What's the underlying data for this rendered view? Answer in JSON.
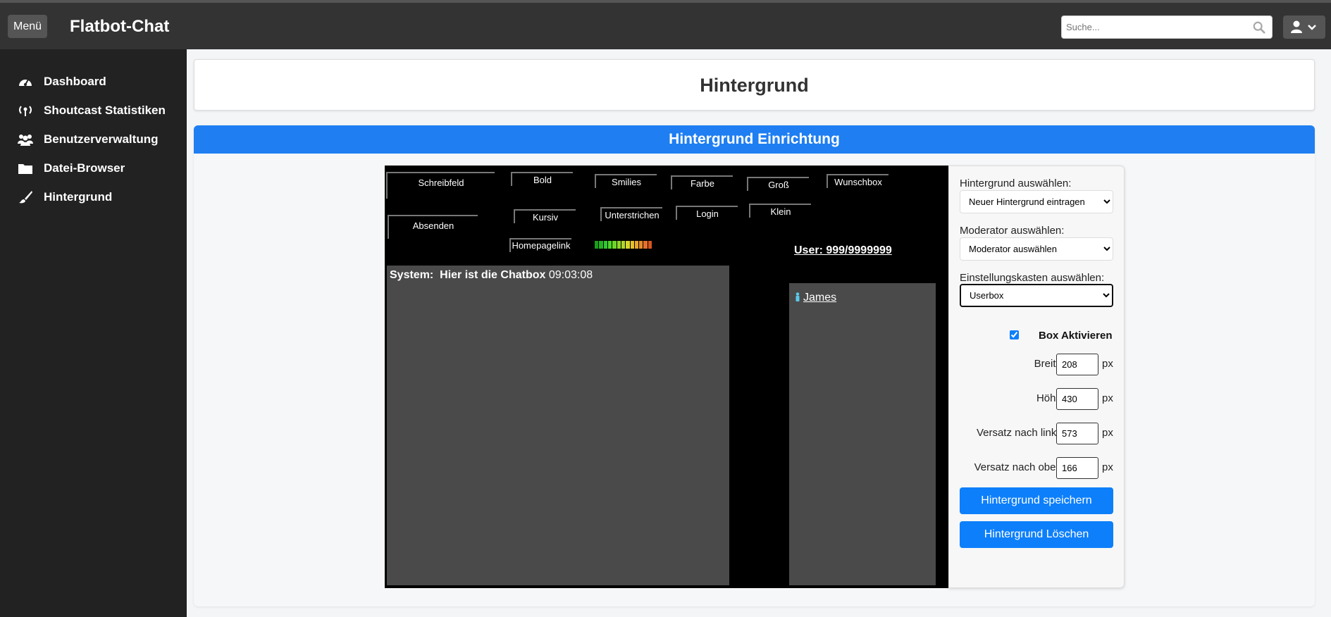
{
  "topbar": {
    "menu_label": "Menü",
    "brand": "Flatbot-Chat",
    "search_placeholder": "Suche..."
  },
  "sidebar": {
    "items": [
      {
        "label": "Dashboard",
        "icon": "dashboard-gauge-icon"
      },
      {
        "label": "Shoutcast Statistiken",
        "icon": "broadcast-antenna-icon"
      },
      {
        "label": "Benutzerverwaltung",
        "icon": "users-icon"
      },
      {
        "label": "Datei-Browser",
        "icon": "folder-icon"
      },
      {
        "label": "Hintergrund",
        "icon": "paintbrush-icon"
      }
    ]
  },
  "page": {
    "title": "Hintergrund",
    "section_title": "Hintergrund Einrichtung"
  },
  "preview": {
    "buttons": {
      "schreibfeld": "Schreibfeld",
      "bold": "Bold",
      "smilies": "Smilies",
      "farbe": "Farbe",
      "gross": "Groß",
      "wunschbox": "Wunschbox",
      "absenden": "Absenden",
      "kursiv": "Kursiv",
      "unterstrichen": "Unterstrichen",
      "login": "Login",
      "klein": "Klein",
      "homepagelink": "Homepagelink"
    },
    "user_count": "User: 999/9999999",
    "chat_sender": "System:",
    "chat_message": "Hier ist die Chatbox",
    "chat_time": "09:03:08",
    "user_name": "James"
  },
  "panel": {
    "background_label": "Hintergrund auswählen:",
    "background_value": "Neuer Hintergrund eintragen",
    "moderator_label": "Moderator auswählen:",
    "moderator_value": "Moderator auswählen",
    "settings_label": "Einstellungskasten auswählen:",
    "settings_value": "Userbox",
    "activate_label": "Box Aktivieren",
    "activate_checked": true,
    "width_label": "Breite:",
    "width_value": "208",
    "height_label": "Höhe:",
    "height_value": "430",
    "offset_left_label": "Versatz nach links:",
    "offset_left_value": "573",
    "offset_top_label": "Versatz nach oben:",
    "offset_top_value": "166",
    "unit": "px",
    "save_label": "Hintergrund speichern",
    "delete_label": "Hintergrund Löschen"
  },
  "colors": {
    "accent": "#1e7ef2",
    "sidebar": "#222222",
    "topbar": "#333333"
  }
}
